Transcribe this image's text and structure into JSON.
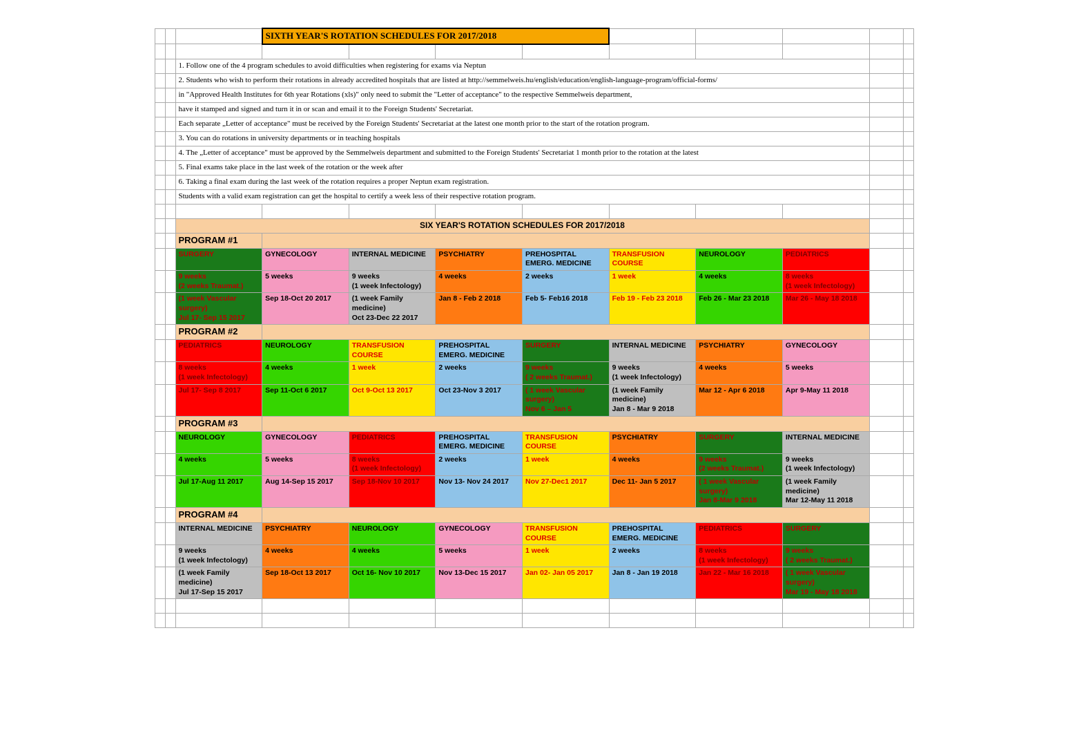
{
  "title": "SIXTH YEAR'S ROTATION SCHEDULES FOR 2017/2018",
  "notes": [
    "1. Follow one of the 4 program schedules to avoid difficulties when registering for exams via Neptun",
    "2. Students who wish to perform their rotations in already accredited hospitals that are listed at http://semmelweis.hu/english/education/english-language-program/official-forms/",
    "    in \"Approved Health Institutes for 6th year Rotations (xls)\" only need to submit the \"Letter of acceptance\" to the respective Semmelweis department,",
    "    have it stamped and signed and turn it in or scan and email it to the Foreign Students' Secretariat.",
    "    Each separate „Letter of acceptance\" must be received by the Foreign Students' Secretariat at the latest one month prior to the start of the rotation program.",
    "3. You can do rotations in university departments or in teaching hospitals",
    "4. The „Letter of acceptance\" must be approved by the Semmelweis department and submitted to the Foreign Students' Secretariat 1 month prior to the rotation at the latest",
    "5. Final exams take place in the last week of the rotation or the week after",
    "6. Taking a final exam during the last week of the rotation requires a proper Neptun exam registration.",
    "    Students with a valid exam registration can get the hospital to certify a week less of their respective rotation program."
  ],
  "subtitle": "SIX YEAR'S ROTATION SCHEDULES FOR 2017/2018",
  "programs": [
    {
      "label": "PROGRAM #1",
      "cols": [
        {
          "name": "SURGERY",
          "dur": "9 weeks",
          "sub": "(2 weeks Traumat.)",
          "extra": "(1 week Vascular surgery)",
          "dates": "Jul 17- Sep 15 2017",
          "color": "darkgreen"
        },
        {
          "name": "GYNECOLOGY",
          "dur": "5 weeks",
          "sub": "",
          "extra": "",
          "dates": "Sep 18-Oct 20 2017",
          "color": "pink"
        },
        {
          "name": "INTERNAL MEDICINE",
          "dur": "9 weeks",
          "sub": "(1 week Infectology)",
          "extra": "(1 week Family medicine)",
          "dates": "Oct 23-Dec 22 2017",
          "color": "grey"
        },
        {
          "name": "PSYCHIATRY",
          "dur": "4 weeks",
          "sub": "",
          "extra": "",
          "dates": "Jan 8 - Feb 2 2018",
          "color": "orange"
        },
        {
          "name": "PREHOSPITAL EMERG. MEDICINE",
          "dur": "2 weeks",
          "sub": "",
          "extra": "",
          "dates": "Feb 5- Feb16  2018",
          "color": "blue"
        },
        {
          "name": "TRANSFUSION COURSE",
          "dur": "1 week",
          "sub": "",
          "extra": "",
          "dates": "Feb 19 - Feb 23 2018",
          "color": "yellow"
        },
        {
          "name": "NEUROLOGY",
          "dur": "4 weeks",
          "sub": "",
          "extra": "",
          "dates": "Feb 26 - Mar 23 2018",
          "color": "green"
        },
        {
          "name": "PEDIATRICS",
          "dur": "8 weeks",
          "sub": "(1 week Infectology)",
          "extra": "",
          "dates": "Mar 26 - May 18 2018",
          "color": "red"
        }
      ]
    },
    {
      "label": "PROGRAM #2",
      "cols": [
        {
          "name": "PEDIATRICS",
          "dur": "8 weeks",
          "sub": "(1 week Infectology)",
          "extra": "",
          "dates": "Jul 17- Sep 8 2017",
          "color": "red"
        },
        {
          "name": "NEUROLOGY",
          "dur": "4 weeks",
          "sub": "",
          "extra": "",
          "dates": "Sep 11-Oct 6  2017",
          "color": "green"
        },
        {
          "name": "TRANSFUSION COURSE",
          "dur": "1 week",
          "sub": "",
          "extra": "",
          "dates": "Oct 9-Oct 13 2017",
          "color": "yellow"
        },
        {
          "name": "PREHOSPITAL EMERG. MEDICINE",
          "dur": "2 weeks",
          "sub": "",
          "extra": "",
          "dates": "Oct 23-Nov 3 2017",
          "color": "blue"
        },
        {
          "name": "SURGERY",
          "dur": "9 weeks",
          "sub": "( 2 weeks Traumat.)",
          "extra": "( 1 week Vascular surgery)",
          "dates": "Nov 6 – Jan 5",
          "color": "darkgreen"
        },
        {
          "name": "INTERNAL MEDICINE",
          "dur": "9 weeks",
          "sub": "(1 week Infectology)",
          "extra": "(1 week Family medicine)",
          "dates": "Jan 8 - Mar 9 2018",
          "color": "grey"
        },
        {
          "name": "PSYCHIATRY",
          "dur": "4 weeks",
          "sub": "",
          "extra": "",
          "dates": "Mar 12 - Apr 6 2018",
          "color": "orange"
        },
        {
          "name": "GYNECOLOGY",
          "dur": "5 weeks",
          "sub": "",
          "extra": "",
          "dates": "Apr 9-May 11 2018",
          "color": "pink"
        }
      ]
    },
    {
      "label": "PROGRAM #3",
      "cols": [
        {
          "name": "NEUROLOGY",
          "dur": "4 weeks",
          "sub": "",
          "extra": "",
          "dates": "Jul 17-Aug 11 2017",
          "color": "green"
        },
        {
          "name": "GYNECOLOGY",
          "dur": "5 weeks",
          "sub": "",
          "extra": "",
          "dates": "Aug 14-Sep 15 2017",
          "color": "pink"
        },
        {
          "name": "PEDIATRICS",
          "dur": "8 weeks",
          "sub": "(1 week Infectology)",
          "extra": "",
          "dates": "Sep 18-Nov 10 2017",
          "color": "red"
        },
        {
          "name": "PREHOSPITAL EMERG. MEDICINE",
          "dur": "2 weeks",
          "sub": "",
          "extra": "",
          "dates": "Nov 13- Nov 24 2017",
          "color": "blue"
        },
        {
          "name": "TRANSFUSION COURSE",
          "dur": "1 week",
          "sub": "",
          "extra": "",
          "dates": "Nov 27-Dec1  2017",
          "color": "yellow"
        },
        {
          "name": "PSYCHIATRY",
          "dur": "4 weeks",
          "sub": "",
          "extra": "",
          "dates": "Dec  11- Jan 5 2017",
          "color": "orange"
        },
        {
          "name": "SURGERY",
          "dur": "9 weeks",
          "sub": "(2 weeks Traumat.)",
          "extra": "( 1 week Vascular surgery)",
          "dates": "Jan 8-Mar 9 2018",
          "color": "darkgreen"
        },
        {
          "name": "INTERNAL MEDICINE",
          "dur": "9 weeks",
          "sub": "(1 week Infectology)",
          "extra": "(1 week Family medicine)",
          "dates": "Mar 12-May 11 2018",
          "color": "grey"
        }
      ]
    },
    {
      "label": "PROGRAM #4",
      "cols": [
        {
          "name": "INTERNAL MEDICINE",
          "dur": "9 weeks",
          "sub": "(1 week Infectology)",
          "extra": "(1 week Family medicine)",
          "dates": "Jul 17-Sep 15 2017",
          "color": "grey"
        },
        {
          "name": "PSYCHIATRY",
          "dur": "4 weeks",
          "sub": "",
          "extra": "",
          "dates": "Sep 18-Oct 13 2017",
          "color": "orange"
        },
        {
          "name": "NEUROLOGY",
          "dur": "4 weeks",
          "sub": "",
          "extra": "",
          "dates": "Oct 16- Nov 10 2017",
          "color": "green"
        },
        {
          "name": "GYNECOLOGY",
          "dur": "5 weeks",
          "sub": "",
          "extra": "",
          "dates": "Nov 13-Dec 15 2017",
          "color": "pink"
        },
        {
          "name": "TRANSFUSION COURSE",
          "dur": "1 week",
          "sub": "",
          "extra": "",
          "dates": "Jan 02- Jan 05 2017",
          "color": "yellow"
        },
        {
          "name": "PREHOSPITAL EMERG. MEDICINE",
          "dur": "2 weeks",
          "sub": "",
          "extra": "",
          "dates": "Jan 8 - Jan 19 2018",
          "color": "blue"
        },
        {
          "name": "PEDIATRICS",
          "dur": "8 weeks",
          "sub": "(1 week Infectology)",
          "extra": "",
          "dates": "Jan 22 - Mar 16 2018",
          "color": "red"
        },
        {
          "name": "SURGERY",
          "dur": "9 weeks",
          "sub": "( 2 weeks Traumat.)",
          "extra": "( 1 week Vascular surgery)",
          "dates": "Mar 19 - May 18 2018",
          "color": "darkgreen"
        }
      ]
    }
  ]
}
